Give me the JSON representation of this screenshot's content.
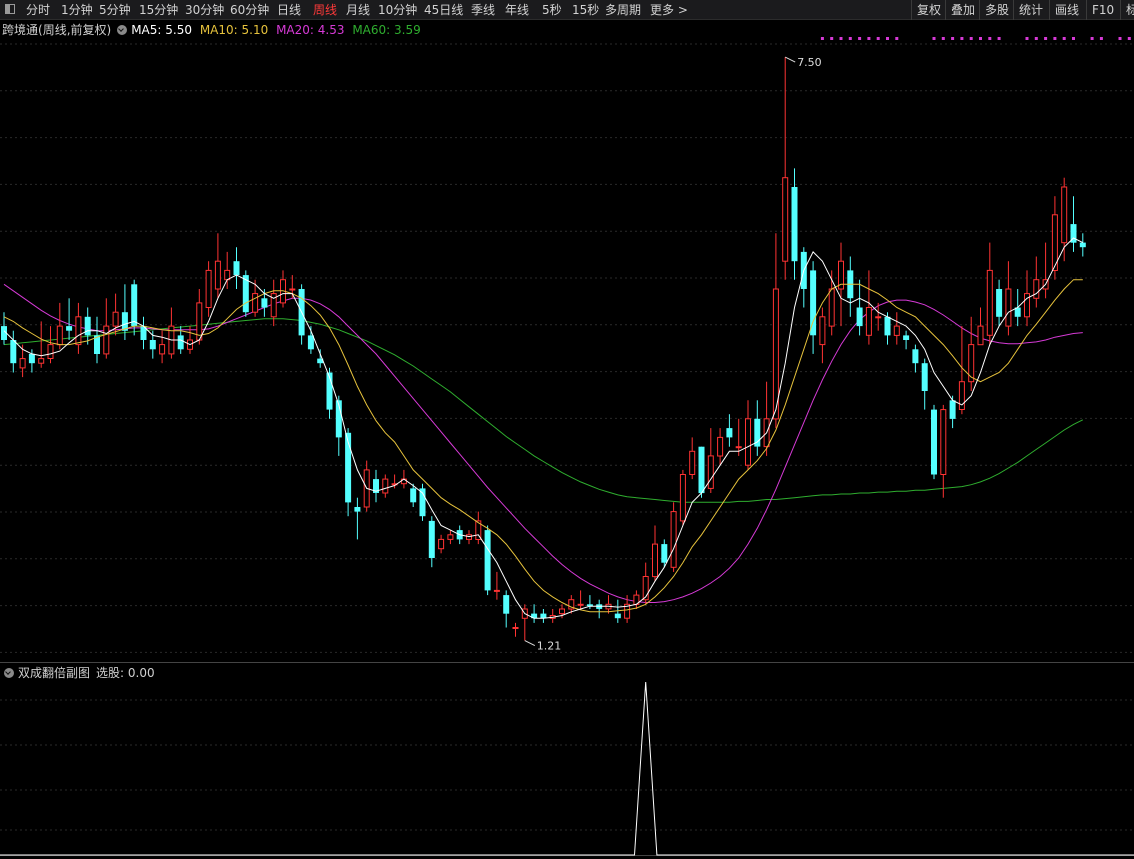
{
  "toolbar": {
    "periods": [
      "分时",
      "1分钟",
      "5分钟",
      "15分钟",
      "30分钟",
      "60分钟",
      "日线",
      "周线",
      "月线",
      "10分钟",
      "45日线",
      "季线",
      "年线",
      "5秒",
      "15秒",
      "多周期",
      "更多 >"
    ],
    "active_period": "周线",
    "right_buttons": [
      "复权",
      "叠加",
      "多股",
      "统计",
      "画线",
      "F10",
      "标"
    ]
  },
  "legend": {
    "stock_name": "跨境通",
    "mode": "(周线,前复权)",
    "ma5": "MA5: 5.50",
    "ma10": "MA10: 5.10",
    "ma20": "MA20: 4.53",
    "ma60": "MA60: 3.59"
  },
  "sub_legend": {
    "indicator_name": "双成翻倍副图",
    "value_label": "选股: 0.00"
  },
  "colors": {
    "up": "#ff3333",
    "down": "#54ffff",
    "ma5": "#ffffff",
    "ma10": "#e6c23c",
    "ma20": "#d63ad6",
    "ma60": "#2fae2f",
    "marker_dots": "#d63ad6",
    "active_tab": "#ff3a3a"
  },
  "chart_data": {
    "type": "candlestick",
    "main_y_range": [
      1.0,
      7.9
    ],
    "annotations": {
      "high": "7.50",
      "low": "1.21"
    },
    "candles": [
      [
        4.6,
        4.45,
        4.75,
        4.4
      ],
      [
        4.45,
        4.2,
        4.55,
        4.1
      ],
      [
        4.15,
        4.25,
        4.4,
        4.05
      ],
      [
        4.3,
        4.2,
        4.35,
        4.1
      ],
      [
        4.2,
        4.25,
        4.65,
        4.15
      ],
      [
        4.25,
        4.4,
        4.6,
        4.2
      ],
      [
        4.4,
        4.6,
        4.85,
        4.35
      ],
      [
        4.6,
        4.55,
        4.9,
        4.45
      ],
      [
        4.4,
        4.7,
        4.85,
        4.3
      ],
      [
        4.7,
        4.5,
        4.8,
        4.4
      ],
      [
        4.5,
        4.3,
        4.7,
        4.2
      ],
      [
        4.3,
        4.6,
        4.9,
        4.25
      ],
      [
        4.6,
        4.75,
        4.95,
        4.5
      ],
      [
        4.75,
        4.55,
        5.05,
        4.45
      ],
      [
        5.05,
        4.6,
        5.1,
        4.5
      ],
      [
        4.6,
        4.45,
        4.7,
        4.35
      ],
      [
        4.45,
        4.35,
        4.55,
        4.25
      ],
      [
        4.3,
        4.4,
        4.55,
        4.2
      ],
      [
        4.3,
        4.6,
        4.8,
        4.25
      ],
      [
        4.5,
        4.35,
        4.6,
        4.3
      ],
      [
        4.35,
        4.45,
        4.6,
        4.3
      ],
      [
        4.45,
        4.85,
        5.0,
        4.4
      ],
      [
        4.8,
        5.2,
        5.3,
        4.7
      ],
      [
        5.0,
        5.3,
        5.6,
        4.9
      ],
      [
        5.1,
        5.2,
        5.4,
        5.0
      ],
      [
        5.3,
        5.15,
        5.45,
        5.0
      ],
      [
        5.15,
        4.75,
        5.2,
        4.7
      ],
      [
        4.75,
        4.95,
        5.1,
        4.7
      ],
      [
        4.9,
        4.8,
        5.0,
        4.7
      ],
      [
        4.7,
        4.95,
        5.1,
        4.6
      ],
      [
        4.85,
        5.1,
        5.2,
        4.8
      ],
      [
        5.0,
        5.0,
        5.15,
        4.9
      ],
      [
        5.0,
        4.5,
        5.05,
        4.4
      ],
      [
        4.5,
        4.35,
        4.6,
        4.3
      ],
      [
        4.25,
        4.2,
        4.35,
        4.15
      ],
      [
        4.1,
        3.7,
        4.15,
        3.6
      ],
      [
        3.8,
        3.4,
        3.85,
        3.2
      ],
      [
        3.45,
        2.7,
        3.5,
        2.55
      ],
      [
        2.65,
        2.6,
        2.75,
        2.3
      ],
      [
        2.65,
        3.05,
        3.15,
        2.6
      ],
      [
        2.95,
        2.8,
        3.05,
        2.7
      ],
      [
        2.8,
        2.95,
        3.0,
        2.75
      ],
      [
        2.9,
        2.9,
        3.0,
        2.85
      ],
      [
        2.9,
        2.95,
        3.05,
        2.85
      ],
      [
        2.85,
        2.7,
        2.9,
        2.65
      ],
      [
        2.85,
        2.55,
        2.9,
        2.5
      ],
      [
        2.5,
        2.1,
        2.55,
        2.0
      ],
      [
        2.2,
        2.3,
        2.35,
        2.15
      ],
      [
        2.3,
        2.35,
        2.4,
        2.25
      ],
      [
        2.4,
        2.3,
        2.45,
        2.25
      ],
      [
        2.3,
        2.35,
        2.4,
        2.25
      ],
      [
        2.3,
        2.5,
        2.6,
        2.25
      ],
      [
        2.4,
        1.75,
        2.45,
        1.7
      ],
      [
        1.75,
        1.75,
        1.95,
        1.65
      ],
      [
        1.7,
        1.5,
        1.75,
        1.35
      ],
      [
        1.35,
        1.35,
        1.4,
        1.25
      ],
      [
        1.45,
        1.55,
        1.6,
        1.21
      ],
      [
        1.5,
        1.45,
        1.6,
        1.4
      ],
      [
        1.5,
        1.45,
        1.55,
        1.4
      ],
      [
        1.45,
        1.48,
        1.55,
        1.4
      ],
      [
        1.5,
        1.55,
        1.6,
        1.45
      ],
      [
        1.55,
        1.65,
        1.7,
        1.5
      ],
      [
        1.6,
        1.6,
        1.75,
        1.55
      ],
      [
        1.6,
        1.58,
        1.7,
        1.55
      ],
      [
        1.6,
        1.55,
        1.65,
        1.45
      ],
      [
        1.55,
        1.6,
        1.7,
        1.5
      ],
      [
        1.5,
        1.45,
        1.65,
        1.4
      ],
      [
        1.45,
        1.6,
        1.7,
        1.4
      ],
      [
        1.6,
        1.7,
        1.75,
        1.55
      ],
      [
        1.65,
        1.9,
        2.05,
        1.6
      ],
      [
        1.9,
        2.25,
        2.45,
        1.85
      ],
      [
        2.25,
        2.05,
        2.3,
        2.0
      ],
      [
        2.0,
        2.6,
        2.7,
        1.95
      ],
      [
        2.5,
        3.0,
        3.05,
        2.45
      ],
      [
        3.0,
        3.25,
        3.4,
        2.95
      ],
      [
        3.3,
        2.8,
        3.3,
        2.75
      ],
      [
        2.85,
        3.2,
        3.5,
        2.8
      ],
      [
        3.2,
        3.4,
        3.5,
        3.1
      ],
      [
        3.5,
        3.4,
        3.65,
        3.3
      ],
      [
        3.3,
        3.3,
        3.6,
        3.2
      ],
      [
        3.1,
        3.6,
        3.8,
        3.05
      ],
      [
        3.6,
        3.3,
        3.8,
        3.2
      ],
      [
        3.3,
        3.6,
        4.0,
        3.2
      ],
      [
        3.6,
        5.0,
        5.6,
        3.5
      ],
      [
        5.3,
        6.2,
        7.5,
        5.1
      ],
      [
        6.1,
        5.3,
        6.3,
        5.1
      ],
      [
        5.4,
        5.0,
        5.45,
        4.8
      ],
      [
        5.2,
        4.5,
        5.3,
        4.3
      ],
      [
        4.4,
        4.7,
        4.8,
        4.2
      ],
      [
        4.6,
        5.0,
        5.2,
        4.5
      ],
      [
        5.0,
        5.3,
        5.5,
        4.6
      ],
      [
        5.2,
        4.9,
        5.35,
        4.7
      ],
      [
        4.8,
        4.6,
        5.1,
        4.5
      ],
      [
        4.5,
        4.8,
        5.2,
        4.4
      ],
      [
        4.7,
        4.7,
        4.85,
        4.55
      ],
      [
        4.7,
        4.5,
        4.75,
        4.4
      ],
      [
        4.5,
        4.6,
        4.75,
        4.4
      ],
      [
        4.5,
        4.45,
        4.55,
        4.35
      ],
      [
        4.35,
        4.2,
        4.4,
        4.1
      ],
      [
        4.2,
        3.9,
        4.25,
        3.7
      ],
      [
        3.7,
        3.0,
        3.75,
        2.95
      ],
      [
        3.0,
        3.7,
        3.75,
        2.75
      ],
      [
        3.8,
        3.6,
        3.85,
        3.5
      ],
      [
        3.7,
        4.0,
        4.6,
        3.65
      ],
      [
        4.0,
        4.4,
        4.7,
        3.9
      ],
      [
        4.4,
        4.6,
        4.8,
        4.4
      ],
      [
        4.5,
        5.2,
        5.5,
        4.4
      ],
      [
        5.0,
        4.7,
        5.1,
        4.6
      ],
      [
        4.6,
        5.0,
        5.3,
        4.5
      ],
      [
        4.8,
        4.7,
        5.0,
        4.6
      ],
      [
        4.7,
        4.95,
        5.2,
        4.6
      ],
      [
        4.9,
        5.1,
        5.35,
        4.8
      ],
      [
        5.0,
        5.1,
        5.5,
        4.9
      ],
      [
        5.2,
        5.8,
        6.0,
        5.1
      ],
      [
        5.5,
        6.1,
        6.2,
        5.3
      ],
      [
        5.7,
        5.5,
        6.0,
        5.4
      ],
      [
        5.5,
        5.45,
        5.6,
        5.35
      ]
    ],
    "ma5": [
      4.55,
      4.45,
      4.35,
      4.3,
      4.28,
      4.3,
      4.33,
      4.42,
      4.5,
      4.55,
      4.55,
      4.52,
      4.58,
      4.62,
      4.65,
      4.6,
      4.5,
      4.48,
      4.45,
      4.45,
      4.4,
      4.45,
      4.65,
      4.9,
      5.1,
      5.15,
      5.1,
      5.05,
      4.95,
      4.9,
      4.95,
      4.95,
      4.75,
      4.55,
      4.3,
      4.05,
      3.75,
      3.35,
      3.05,
      2.85,
      2.82,
      2.85,
      2.88,
      2.95,
      2.88,
      2.8,
      2.62,
      2.45,
      2.4,
      2.35,
      2.33,
      2.35,
      2.2,
      2.05,
      1.85,
      1.65,
      1.5,
      1.45,
      1.45,
      1.46,
      1.48,
      1.52,
      1.55,
      1.58,
      1.58,
      1.58,
      1.57,
      1.58,
      1.6,
      1.68,
      1.85,
      2.0,
      2.2,
      2.45,
      2.7,
      2.8,
      2.95,
      3.1,
      3.25,
      3.25,
      3.3,
      3.35,
      3.45,
      3.7,
      4.2,
      4.8,
      5.2,
      5.4,
      5.3,
      5.1,
      4.9,
      4.85,
      4.9,
      4.85,
      4.75,
      4.7,
      4.65,
      4.6,
      4.5,
      4.35,
      4.1,
      3.95,
      3.8,
      3.75,
      3.85,
      4.1,
      4.4,
      4.6,
      4.75,
      4.8,
      4.9,
      4.95,
      5.05,
      5.25,
      5.45,
      5.55,
      5.5
    ],
    "ma10": [
      4.7,
      4.65,
      4.58,
      4.52,
      4.46,
      4.42,
      4.4,
      4.4,
      4.42,
      4.44,
      4.48,
      4.51,
      4.54,
      4.57,
      4.6,
      4.6,
      4.58,
      4.56,
      4.55,
      4.55,
      4.53,
      4.5,
      4.52,
      4.58,
      4.68,
      4.78,
      4.85,
      4.9,
      4.95,
      4.98,
      4.98,
      4.95,
      4.9,
      4.82,
      4.72,
      4.58,
      4.4,
      4.18,
      3.95,
      3.75,
      3.58,
      3.45,
      3.35,
      3.2,
      3.05,
      2.95,
      2.85,
      2.75,
      2.68,
      2.62,
      2.55,
      2.48,
      2.42,
      2.35,
      2.25,
      2.12,
      1.98,
      1.85,
      1.75,
      1.68,
      1.62,
      1.57,
      1.54,
      1.52,
      1.52,
      1.52,
      1.53,
      1.54,
      1.56,
      1.6,
      1.68,
      1.78,
      1.9,
      2.05,
      2.22,
      2.35,
      2.5,
      2.65,
      2.8,
      2.95,
      3.05,
      3.15,
      3.28,
      3.48,
      3.75,
      4.05,
      4.35,
      4.65,
      4.85,
      5.0,
      5.05,
      5.05,
      5.05,
      5.0,
      4.95,
      4.88,
      4.8,
      4.75,
      4.7,
      4.6,
      4.5,
      4.4,
      4.28,
      4.15,
      4.05,
      4.0,
      4.05,
      4.1,
      4.2,
      4.35,
      4.5,
      4.62,
      4.75,
      4.88,
      5.0,
      5.1,
      5.1
    ],
    "ma20": [
      5.05,
      4.98,
      4.91,
      4.84,
      4.77,
      4.71,
      4.66,
      4.62,
      4.59,
      4.57,
      4.55,
      4.55,
      4.56,
      4.57,
      4.58,
      4.58,
      4.57,
      4.56,
      4.56,
      4.56,
      4.56,
      4.56,
      4.57,
      4.6,
      4.64,
      4.68,
      4.72,
      4.76,
      4.8,
      4.84,
      4.87,
      4.9,
      4.9,
      4.88,
      4.84,
      4.78,
      4.7,
      4.6,
      4.5,
      4.4,
      4.3,
      4.18,
      4.06,
      3.94,
      3.82,
      3.7,
      3.58,
      3.46,
      3.34,
      3.22,
      3.1,
      2.98,
      2.86,
      2.75,
      2.64,
      2.53,
      2.42,
      2.32,
      2.22,
      2.12,
      2.03,
      1.95,
      1.88,
      1.82,
      1.77,
      1.72,
      1.68,
      1.65,
      1.63,
      1.62,
      1.62,
      1.63,
      1.65,
      1.68,
      1.72,
      1.77,
      1.83,
      1.9,
      1.99,
      2.1,
      2.25,
      2.42,
      2.62,
      2.84,
      3.08,
      3.32,
      3.56,
      3.8,
      4.02,
      4.22,
      4.4,
      4.55,
      4.67,
      4.75,
      4.82,
      4.86,
      4.88,
      4.88,
      4.86,
      4.83,
      4.78,
      4.72,
      4.65,
      4.58,
      4.52,
      4.47,
      4.44,
      4.42,
      4.41,
      4.41,
      4.42,
      4.43,
      4.45,
      4.48,
      4.5,
      4.52,
      4.53
    ],
    "ma60": [
      4.4,
      4.41,
      4.42,
      4.43,
      4.44,
      4.45,
      4.46,
      4.47,
      4.48,
      4.49,
      4.5,
      4.51,
      4.52,
      4.53,
      4.54,
      4.55,
      4.56,
      4.57,
      4.58,
      4.59,
      4.6,
      4.61,
      4.62,
      4.63,
      4.64,
      4.65,
      4.66,
      4.67,
      4.68,
      4.68,
      4.68,
      4.67,
      4.66,
      4.64,
      4.62,
      4.59,
      4.56,
      4.52,
      4.48,
      4.44,
      4.39,
      4.34,
      4.29,
      4.23,
      4.17,
      4.1,
      4.03,
      3.96,
      3.89,
      3.81,
      3.73,
      3.65,
      3.57,
      3.49,
      3.41,
      3.34,
      3.27,
      3.2,
      3.14,
      3.08,
      3.02,
      2.97,
      2.92,
      2.88,
      2.84,
      2.81,
      2.78,
      2.76,
      2.75,
      2.74,
      2.73,
      2.72,
      2.71,
      2.7,
      2.7,
      2.7,
      2.7,
      2.7,
      2.7,
      2.71,
      2.71,
      2.72,
      2.73,
      2.73,
      2.74,
      2.75,
      2.76,
      2.77,
      2.78,
      2.78,
      2.79,
      2.79,
      2.8,
      2.8,
      2.81,
      2.81,
      2.82,
      2.82,
      2.83,
      2.83,
      2.84,
      2.85,
      2.86,
      2.87,
      2.89,
      2.92,
      2.96,
      3.01,
      3.07,
      3.13,
      3.2,
      3.27,
      3.34,
      3.41,
      3.48,
      3.54,
      3.59
    ],
    "marker_dot_index_ranges": [
      [
        88,
        96
      ],
      [
        100,
        107
      ],
      [
        110,
        115
      ],
      [
        117,
        118
      ],
      [
        120,
        123
      ]
    ],
    "sub_series": {
      "name": "选股",
      "current": 0.0,
      "y_range": [
        0,
        1
      ],
      "spike_index": 69,
      "spike_value": 1
    }
  }
}
